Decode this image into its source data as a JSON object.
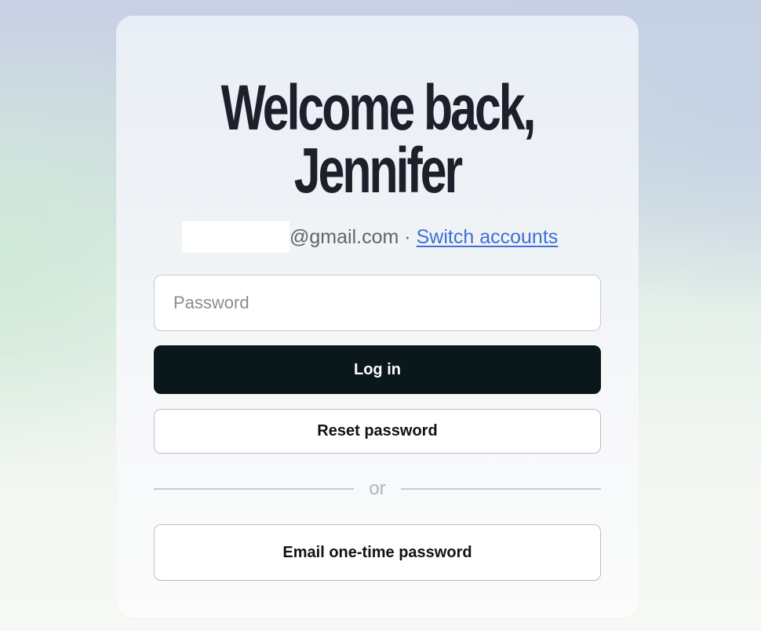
{
  "login": {
    "heading_line1": "Welcome back,",
    "heading_line2": "Jennifer",
    "email_suffix": "@gmail.com",
    "separator": "·",
    "switch_accounts": "Switch accounts",
    "password_placeholder": "Password",
    "login_button": "Log in",
    "reset_button": "Reset password",
    "divider_text": "or",
    "otp_button": "Email one-time password"
  },
  "colors": {
    "primary_button": "#0b181b",
    "link": "#3d6fd6",
    "heading": "#1e1f2b"
  }
}
